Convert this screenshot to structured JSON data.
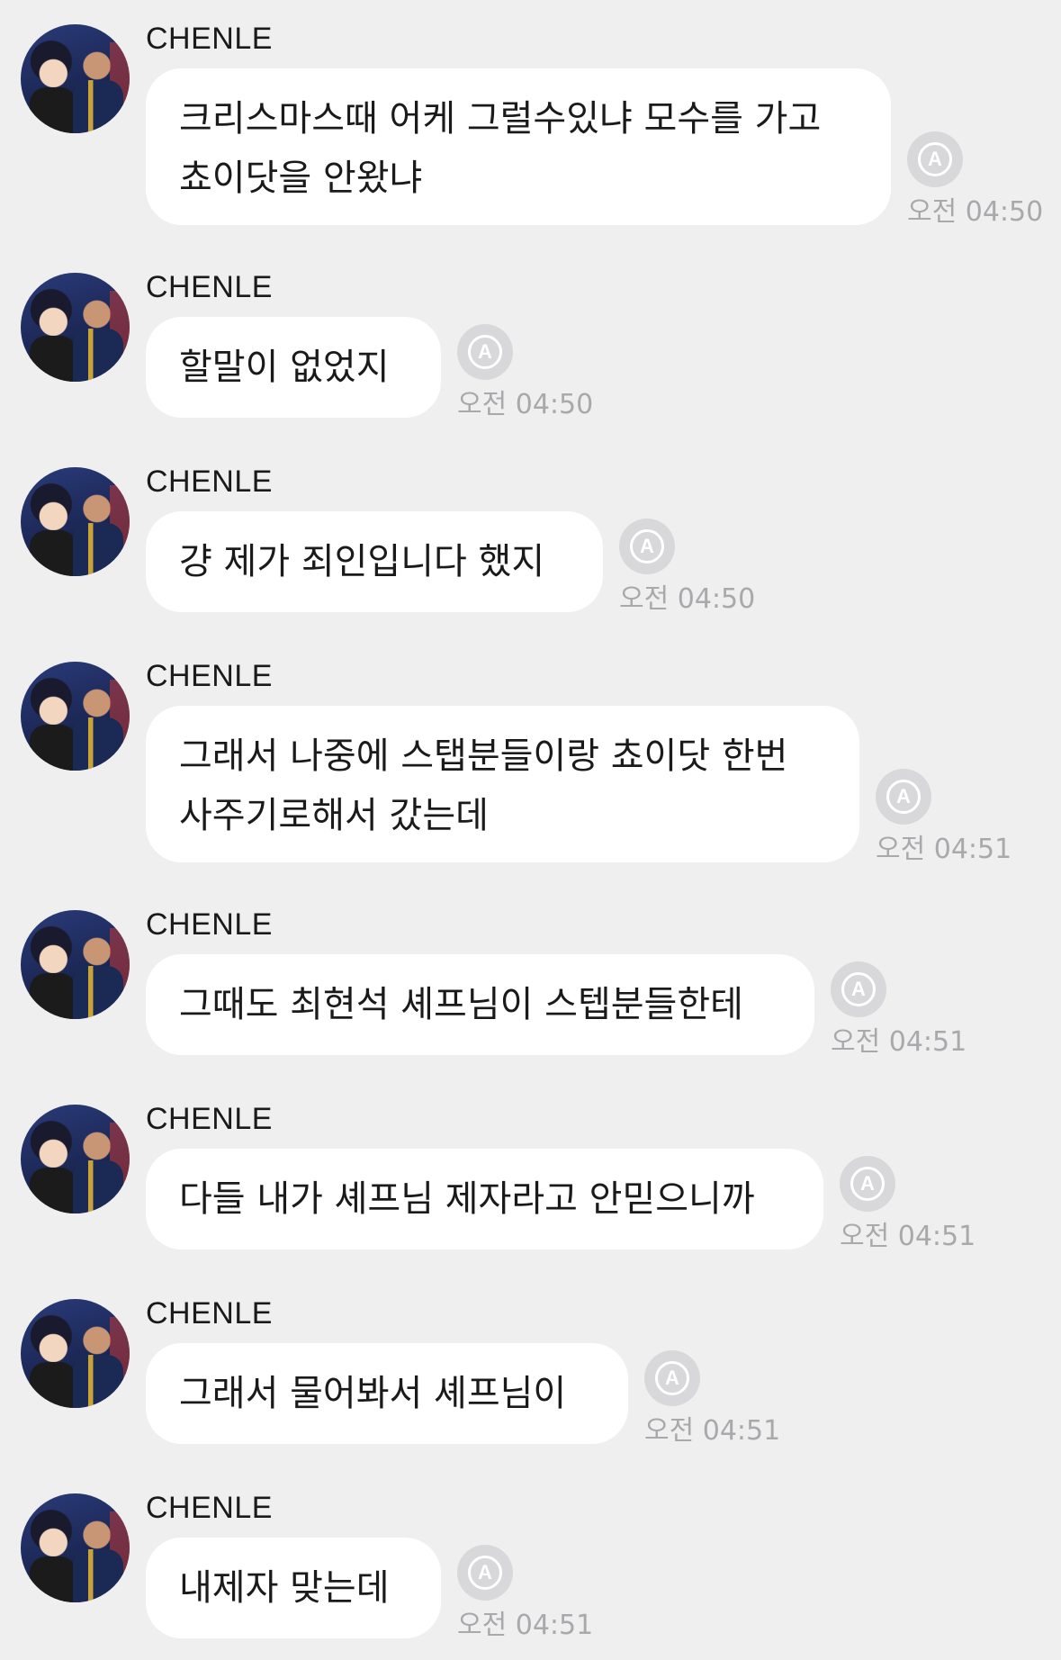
{
  "messages": [
    {
      "sender": "CHENLE",
      "text": "크리스마스때 어케 그럴수있냐 모수를 가고\n쵸이닷을 안왔냐",
      "time": "오전 04:50"
    },
    {
      "sender": "CHENLE",
      "text": "할말이 없었지",
      "time": "오전 04:50"
    },
    {
      "sender": "CHENLE",
      "text": "걍 제가 죄인입니다 했지",
      "time": "오전 04:50"
    },
    {
      "sender": "CHENLE",
      "text": "그래서 나중에 스탭분들이랑 쵸이닷 한번\n사주기로해서 갔는데",
      "time": "오전 04:51"
    },
    {
      "sender": "CHENLE",
      "text": "그때도 최현석 셰프님이 스텝분들한테",
      "time": "오전 04:51"
    },
    {
      "sender": "CHENLE",
      "text": "다들 내가 셰프님 제자라고 안믿으니까",
      "time": "오전 04:51"
    },
    {
      "sender": "CHENLE",
      "text": "그래서 물어봐서 셰프님이",
      "time": "오전 04:51"
    },
    {
      "sender": "CHENLE",
      "text": "내제자 맞는데",
      "time": "오전 04:51"
    }
  ],
  "translate_icon": {
    "icon": "translate-icon",
    "glyph": "A"
  },
  "colors": {
    "background": "#efeff0",
    "bubble": "#ffffff",
    "time": "#a9a9ac",
    "icon": "#d8d8da"
  }
}
